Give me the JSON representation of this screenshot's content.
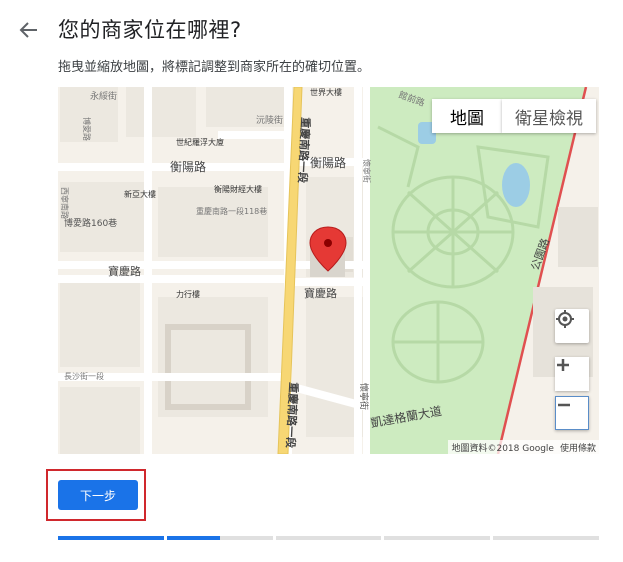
{
  "header": {
    "back_icon": "arrow-left-icon",
    "title": "您的商家位在哪裡?",
    "subtitle": "拖曳並縮放地圖，將標記調整到商家所在的確切位置。"
  },
  "map": {
    "type_buttons": {
      "map": "地圖",
      "satellite": "衛星檢視"
    },
    "controls": {
      "locate_icon": "my-location-icon",
      "zoom_in": "+",
      "zoom_out": "−"
    },
    "attribution": {
      "data": "地圖資料©2018 Google",
      "terms": "使用條款"
    },
    "labels": {
      "l1": "永綏街",
      "l2": "沅陵街",
      "l3": "世界大樓",
      "l4": "世紀羅浮大廈",
      "l5": "衡陽路",
      "l6": "衡陽路",
      "l7": "新亞大樓",
      "l8": "衡陽財經大樓",
      "l9": "重慶南路一段118巷",
      "l10": "博愛路160巷",
      "l11": "寶慶路",
      "l12": "力行樓",
      "l13": "寶慶路",
      "l14": "長沙街一段",
      "l15": "凱達格蘭大道",
      "l16": "懷寧街",
      "l17": "公園路",
      "l18": "重慶南路一段",
      "l19": "重慶南路一段",
      "l20": "懷寧街",
      "l21": "館前路",
      "l22": "西寧南路",
      "l23": "博愛路"
    },
    "colors": {
      "park": "#cdebc0",
      "road_major": "#f7d774",
      "marker": "#e53935",
      "block": "#ece8e0"
    }
  },
  "actions": {
    "next_label": "下一步"
  },
  "progress": {
    "segments": 5,
    "current_fill_fraction": [
      1.0,
      0.5,
      0,
      0,
      0
    ]
  }
}
